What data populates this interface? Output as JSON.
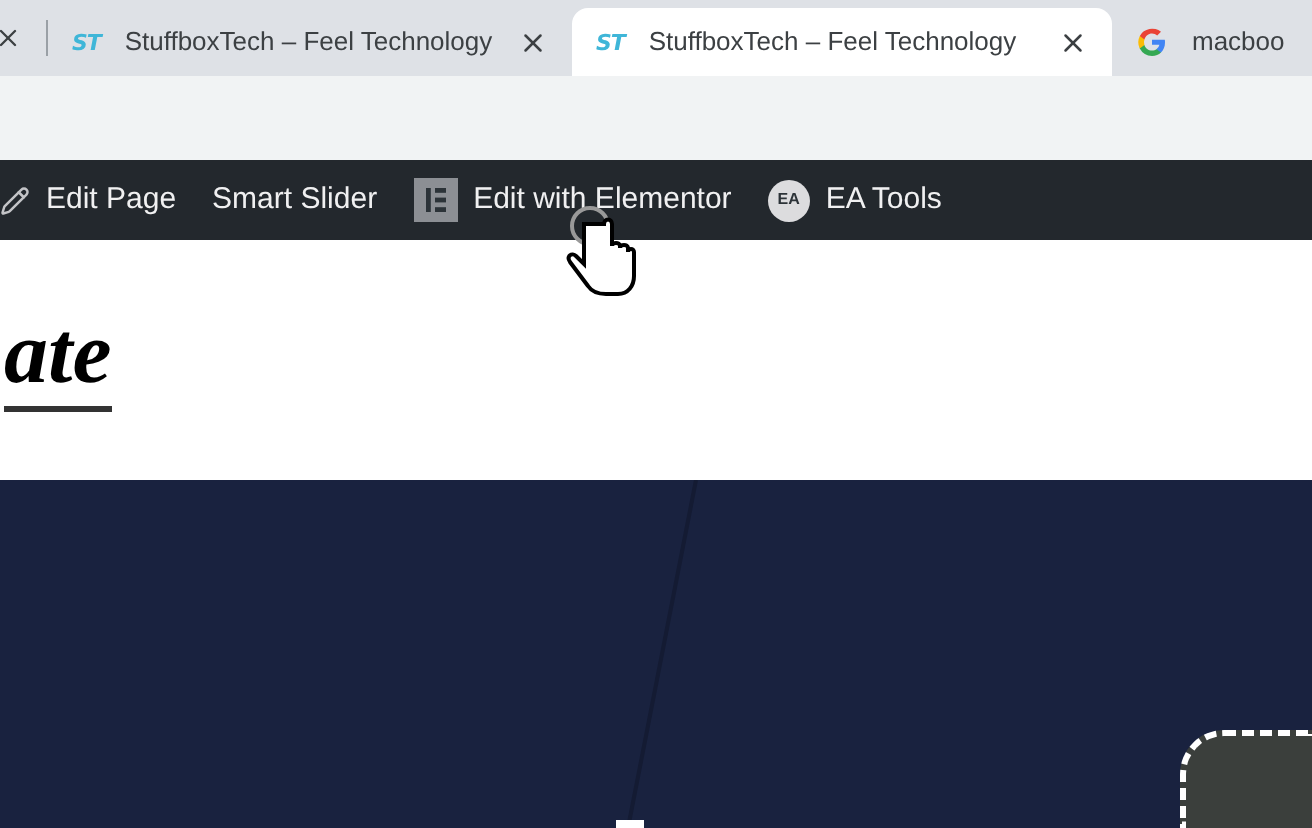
{
  "tabs": [
    {
      "kind": "site",
      "favicon_text": "ST",
      "title": "StuffboxTech – Feel Technology",
      "selected": false
    },
    {
      "kind": "site",
      "favicon_text": "ST",
      "title": "StuffboxTech – Feel Technology",
      "selected": true
    },
    {
      "kind": "google",
      "title": "macboo",
      "selected": false
    }
  ],
  "admin_bar": {
    "items": [
      {
        "kind": "pencil",
        "label": "Edit Page"
      },
      {
        "kind": "plain",
        "label": "Smart Slider"
      },
      {
        "kind": "elementor",
        "label": "Edit with Elementor"
      },
      {
        "kind": "badge",
        "badge": "EA",
        "label": "EA Tools"
      }
    ]
  },
  "header": {
    "logo_text": "ate"
  }
}
